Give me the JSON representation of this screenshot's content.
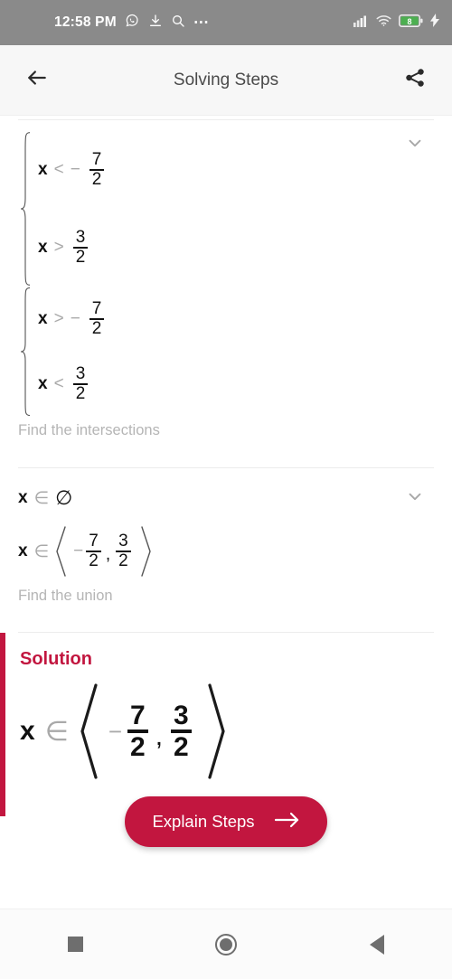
{
  "status_bar": {
    "time": "12:58 PM",
    "battery_level": "8",
    "icons": [
      "whatsapp-icon",
      "download-icon",
      "search-icon",
      "more-icon",
      "signal-icon",
      "wifi-icon",
      "battery-icon",
      "charging-bolt-icon"
    ]
  },
  "app_bar": {
    "title": "Solving Steps",
    "back_icon": "back-arrow-icon",
    "share_icon": "share-icon"
  },
  "steps": [
    {
      "system": [
        {
          "var": "x",
          "op": "<",
          "sign": "−",
          "num": "7",
          "den": "2"
        },
        {
          "var": "x",
          "op": ">",
          "sign": "",
          "num": "3",
          "den": "2"
        }
      ]
    },
    {
      "system": [
        {
          "var": "x",
          "op": ">",
          "sign": "−",
          "num": "7",
          "den": "2"
        },
        {
          "var": "x",
          "op": "<",
          "sign": "",
          "num": "3",
          "den": "2"
        }
      ]
    }
  ],
  "hints": {
    "intersections": "Find the intersections",
    "union": "Find the union"
  },
  "intersection_results": {
    "empty": {
      "var": "x",
      "op": "∈",
      "value": "∅"
    },
    "interval": {
      "var": "x",
      "op": "∈",
      "left_sign": "−",
      "left_num": "7",
      "left_den": "2",
      "comma": ",",
      "right_num": "3",
      "right_den": "2"
    }
  },
  "solution": {
    "title": "Solution",
    "var": "x",
    "op": "∈",
    "left_sign": "−",
    "left_num": "7",
    "left_den": "2",
    "comma": ",",
    "right_num": "3",
    "right_den": "2",
    "accent_color": "#c2163f"
  },
  "cta": {
    "label": "Explain Steps",
    "arrow_icon": "arrow-right-icon"
  },
  "nav_bar": {
    "recents": "recents-square-icon",
    "home": "home-circle-icon",
    "back": "back-triangle-icon"
  }
}
